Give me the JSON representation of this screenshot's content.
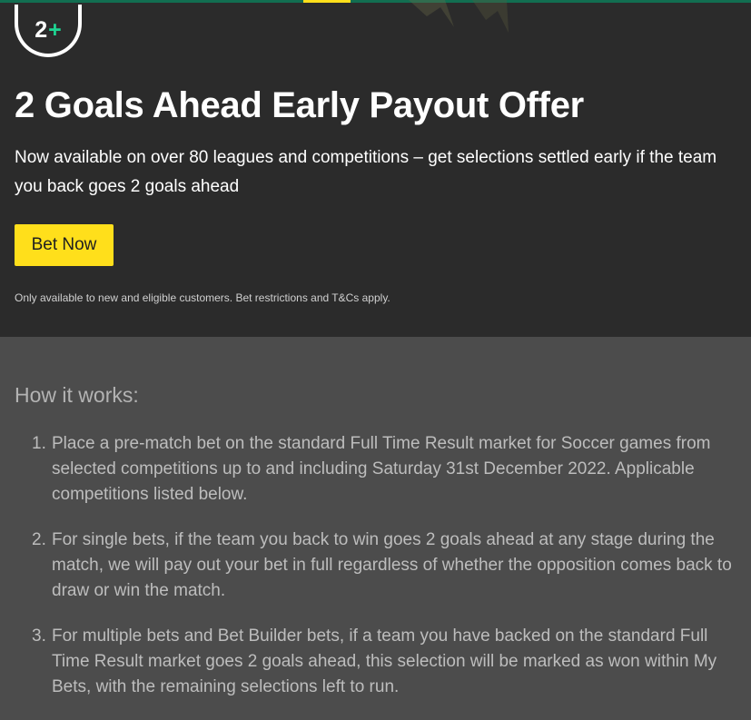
{
  "hero": {
    "badge": {
      "number": "2",
      "plus": "+"
    },
    "title": "2 Goals Ahead Early Payout Offer",
    "subtitle": "Now available on over 80 leagues and competitions – get selections settled early if the team you back goes 2 goals ahead",
    "cta_label": "Bet Now",
    "terms": "Only available to new and eligible customers. Bet restrictions and T&Cs apply."
  },
  "how_it_works": {
    "title": "How it works:",
    "steps": [
      {
        "number": "1.",
        "text": "Place a pre-match bet on the standard Full Time Result market for Soccer games from selected competitions up to and including Saturday 31st December 2022. Applicable competitions listed below."
      },
      {
        "number": "2.",
        "text": "For single bets, if the team you back to win goes 2 goals ahead at any stage during the match, we will pay out your bet in full regardless of whether the opposition comes back to draw or win the match."
      },
      {
        "number": "3.",
        "text": "For multiple bets and Bet Builder bets, if a team you have backed on the standard Full Time Result market goes 2 goals ahead, this selection will be marked as won within My Bets, with the remaining selections left to run."
      }
    ]
  },
  "colors": {
    "hero_background": "#2b2b2b",
    "section_background": "#4c4c4c",
    "cta_yellow": "#ffdf1b",
    "brand_green": "#126e51",
    "plus_green": "#1ed391"
  }
}
